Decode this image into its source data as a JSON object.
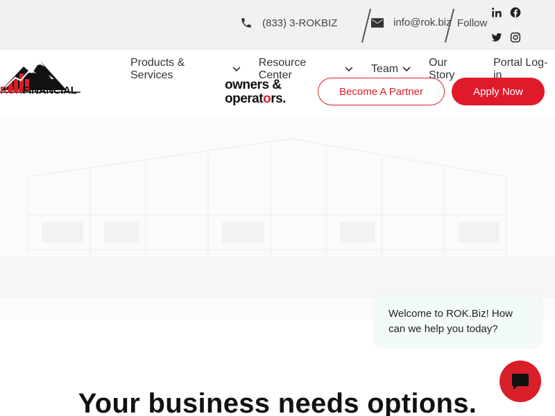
{
  "topbar": {
    "phone": "(833) 3-ROKBIZ",
    "email": "info@rok.biz",
    "follow": "Follow",
    "social_icons": [
      "linkedin-icon",
      "facebook-icon",
      "twitter-icon",
      "instagram-icon"
    ]
  },
  "logo": {
    "prefix": "ROK",
    "suffix": "FINANCIAL"
  },
  "nav": {
    "items": [
      {
        "label": "Products & Services",
        "has_dropdown": true
      },
      {
        "label": "Resource Center",
        "has_dropdown": true
      },
      {
        "label": "Team",
        "has_dropdown": true
      },
      {
        "label": "Our Story",
        "has_dropdown": false
      },
      {
        "label": "Portal Log-in",
        "has_dropdown": false
      }
    ]
  },
  "partner_logo": {
    "line1": "owners &",
    "line2": "operat",
    "line2_accent": "o",
    "line2_end": "rs."
  },
  "buttons": {
    "become_partner": "Become A Partner",
    "apply_now": "Apply Now"
  },
  "chat": {
    "message": "Welcome to ROK.Biz! How can we help you today?"
  },
  "hero": {
    "headline": "Your business needs options."
  },
  "colors": {
    "brand_red": "#e01a2b",
    "topbar_bg": "#f1f1f1",
    "chat_bg": "#f3fbf9"
  }
}
